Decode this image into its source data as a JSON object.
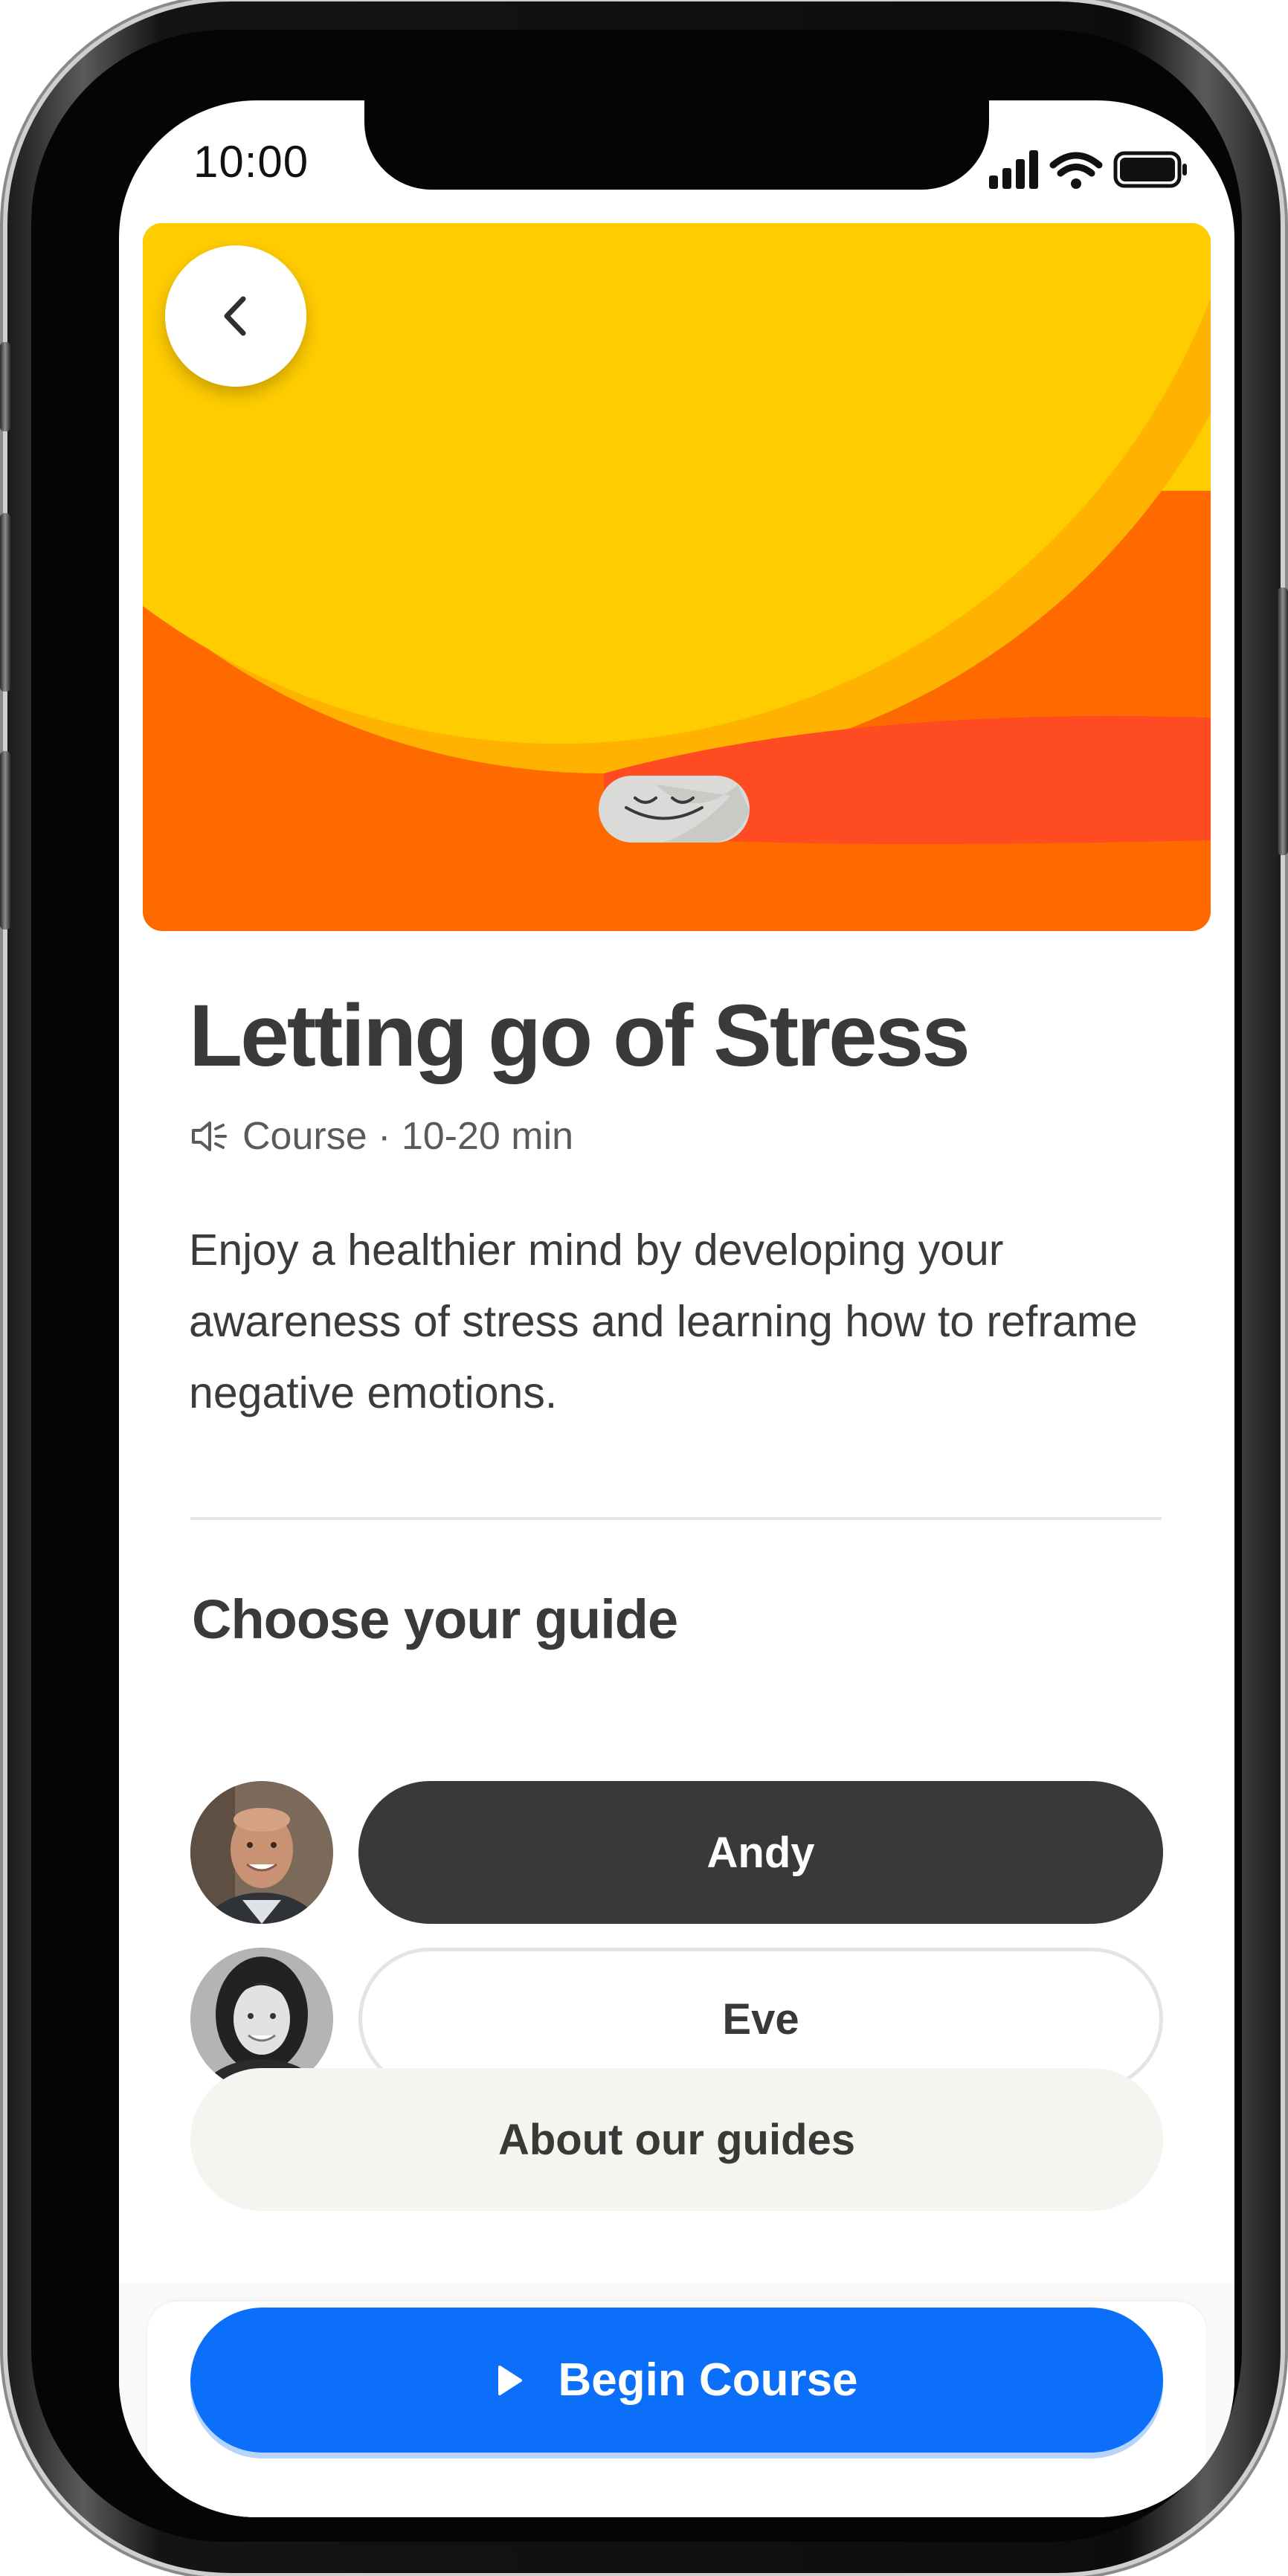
{
  "status_bar": {
    "time": "10:00",
    "icons": [
      "signal-icon",
      "wifi-icon",
      "battery-icon"
    ]
  },
  "hero": {
    "colors": {
      "sun": "#FFCC00",
      "sun_shade": "#FFB300",
      "ground": "#FF6A00",
      "band": "#FF4B22"
    },
    "back_icon": "chevron-left-icon",
    "mascot_icon": "smiling-face-icon"
  },
  "course": {
    "title": "Letting go of Stress",
    "meta_icon": "speaker-icon",
    "meta": "Course · 10-20 min",
    "description": "Enjoy a healthier mind by developing your awareness of stress and learning how to reframe negative emotions."
  },
  "guides": {
    "heading": "Choose your guide",
    "items": [
      {
        "name": "Andy",
        "selected": true
      },
      {
        "name": "Eve",
        "selected": false
      }
    ],
    "about_label": "About our guides"
  },
  "cta": {
    "label": "Begin Course",
    "icon": "play-icon",
    "color": "#0C6FFA"
  }
}
